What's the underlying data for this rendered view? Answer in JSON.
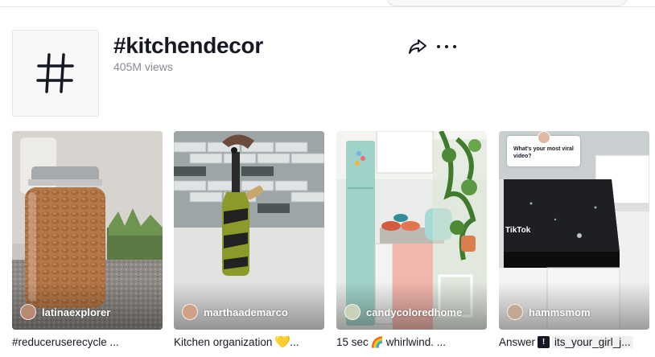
{
  "header": {
    "title": "#kitchendecor",
    "views": "405M views",
    "hashtag_icon": "hashtag-icon",
    "share_icon": "share-arrow-icon",
    "more_icon": "more-dots-icon"
  },
  "videos": [
    {
      "author": "latinaexplorer",
      "caption": "#reduceruserecycle ..."
    },
    {
      "author": "marthaademarco",
      "caption_before": "Kitchen organization",
      "caption_emoji": "💛",
      "caption_after": "..."
    },
    {
      "author": "candycoloredhome",
      "caption_before": "15 sec",
      "caption_emoji": "🌈",
      "caption_after": "whirlwind. ..."
    },
    {
      "author": "hammsmom",
      "caption_before": "Answer",
      "caption_tag": "its_your_girl_j...",
      "overlay_question": "What's your most viral video?",
      "overlay_brand": "TikTok"
    }
  ],
  "colors": {
    "text": "#161823",
    "muted": "#8a8b91",
    "border": "#e3e3e4",
    "yellow_heart": "#f7c800"
  }
}
